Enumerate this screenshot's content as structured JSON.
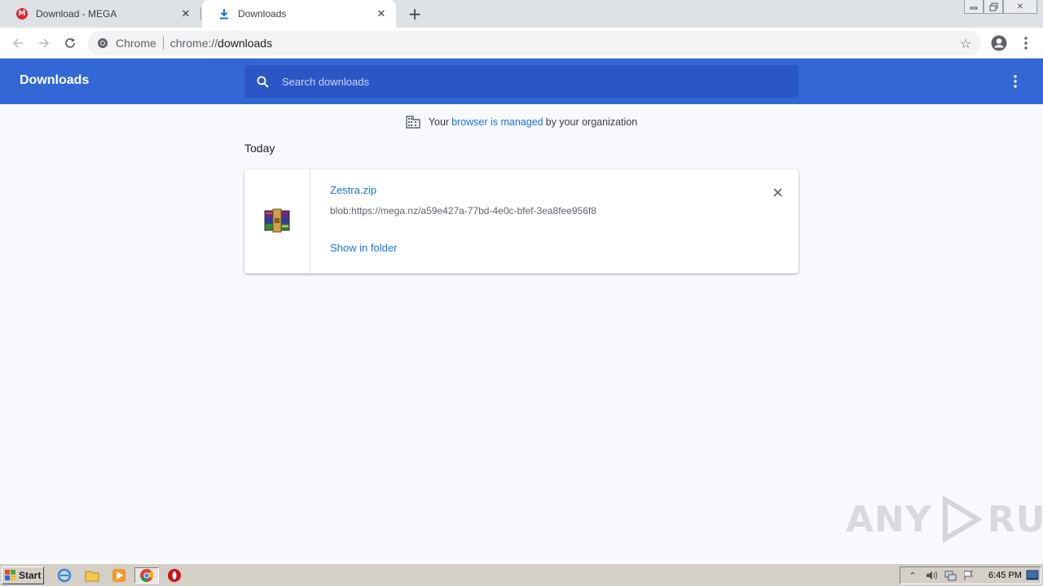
{
  "tabs": [
    {
      "title": "Download - MEGA",
      "favicon": "mega-icon"
    },
    {
      "title": "Downloads",
      "favicon": "download-icon",
      "active": true
    }
  ],
  "toolbar": {
    "site_name": "Chrome",
    "url_scheme": "chrome://",
    "url_host": "downloads"
  },
  "downloads": {
    "title": "Downloads",
    "search_placeholder": "Search downloads",
    "managed": {
      "prefix": "Your",
      "link": "browser is managed",
      "suffix": "by your organization"
    },
    "section_date": "Today",
    "items": [
      {
        "file_name": "Zestra.zip",
        "url": "blob:https://mega.nz/a59e427a-77bd-4e0c-bfef-3ea8fee956f8",
        "action": "Show in folder",
        "icon": "winrar-archive-icon"
      }
    ]
  },
  "watermark": {
    "left": "ANY",
    "right": "RUN"
  },
  "taskbar": {
    "start_label": "Start",
    "clock": "6:45 PM"
  },
  "colors": {
    "header_blue": "#3367d6",
    "search_blue": "#2a56c6",
    "link_blue": "#1a73e8"
  }
}
